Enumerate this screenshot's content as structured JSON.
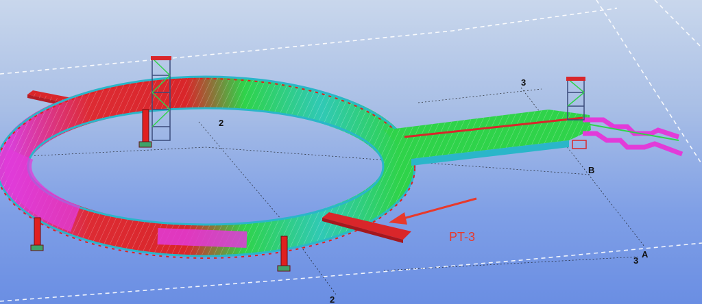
{
  "viewport": {
    "background_top": "#c9d7ec",
    "background_bottom": "#6a8ee3"
  },
  "grid": {
    "labels": {
      "grid_2_top": "2",
      "grid_3_top": "3",
      "grid_b": "B",
      "grid_a": "A",
      "grid_3_bottom": "3",
      "grid_2_bottom": "2"
    },
    "line_color": "#ffffff",
    "axis_color": "#111111"
  },
  "annotation": {
    "label": "PT-3",
    "color": "#e8392b"
  },
  "model": {
    "colors": {
      "deck_red": "#d9262a",
      "deck_green": "#2fd34a",
      "deck_magenta": "#e23bd9",
      "deck_cyan": "#2ab6c9",
      "deck_blue": "#3a6fe0",
      "column_red": "#e0201f",
      "tower_frame": "#3a4b7a"
    }
  }
}
